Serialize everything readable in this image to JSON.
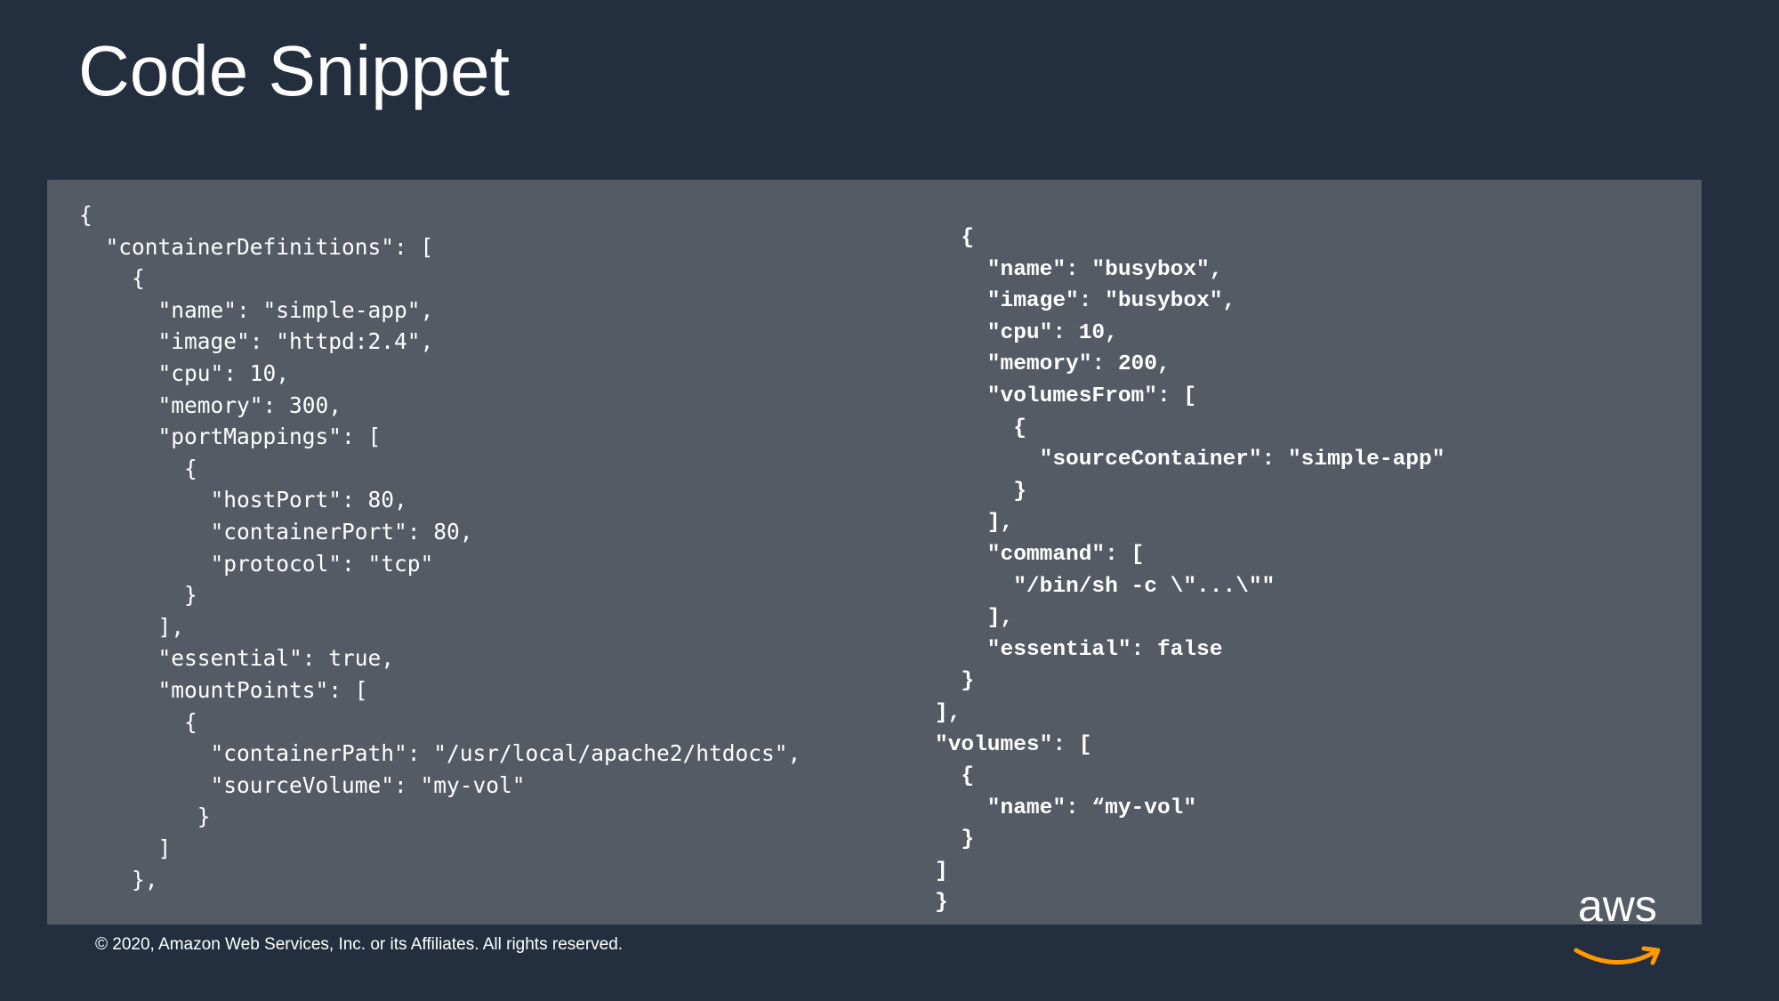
{
  "slide": {
    "title": "Code Snippet",
    "footer": "© 2020, Amazon Web Services, Inc. or its Affiliates. All rights reserved.",
    "logo_text": "aws",
    "logo_accent_color": "#ff9900",
    "background_color": "#232f3e",
    "panel_color": "#545b64"
  },
  "code": {
    "left": "{\n  \"containerDefinitions\": [\n    {\n      \"name\": \"simple-app\",\n      \"image\": \"httpd:2.4\",\n      \"cpu\": 10,\n      \"memory\": 300,\n      \"portMappings\": [\n        {\n          \"hostPort\": 80,\n          \"containerPort\": 80,\n          \"protocol\": \"tcp\"\n        }\n      ],\n      \"essential\": true,\n      \"mountPoints\": [\n        {\n          \"containerPath\": \"/usr/local/apache2/htdocs\",\n          \"sourceVolume\": \"my-vol\"\n         }\n      ]\n    },",
    "right": "  {\n    \"name\": \"busybox\",\n    \"image\": \"busybox\",\n    \"cpu\": 10,\n    \"memory\": 200,\n    \"volumesFrom\": [\n      {\n        \"sourceContainer\": \"simple-app\"\n      }\n    ],\n    \"command\": [\n      \"/bin/sh -c \\\"...\\\"\"\n    ],\n    \"essential\": false\n  }\n],\n\"volumes\": [\n  {\n    \"name\": “my-vol\"\n  }\n]\n}"
  }
}
